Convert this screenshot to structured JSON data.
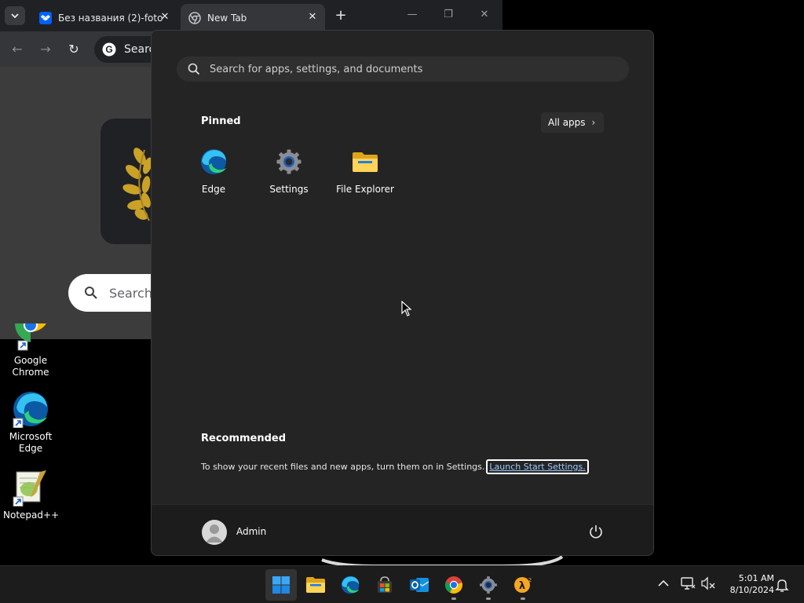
{
  "browser": {
    "tabs": [
      {
        "title": "Без названия (2)-foto"
      },
      {
        "title": "New Tab"
      }
    ],
    "toolbar": {
      "omnibox_text": "Search"
    },
    "ntp": {
      "search_text": "Search"
    }
  },
  "desktop": {
    "icons": [
      {
        "label": "Google\nChrome"
      },
      {
        "label": "Microsoft\nEdge"
      },
      {
        "label": "Notepad++"
      }
    ]
  },
  "start_menu": {
    "search_placeholder": "Search for apps, settings, and documents",
    "pinned_title": "Pinned",
    "all_apps_label": "All apps",
    "pinned_apps": [
      {
        "label": "Edge",
        "icon": "edge-icon"
      },
      {
        "label": "Settings",
        "icon": "settings-gear-icon"
      },
      {
        "label": "File Explorer",
        "icon": "folder-icon"
      }
    ],
    "recommended_title": "Recommended",
    "recommended_text": "To show your recent files and new apps, turn them on in Settings.",
    "recommended_link": "Launch Start Settings.",
    "user_name": "Admin"
  },
  "taskbar": {
    "apps": [
      "windows-start-icon",
      "file-explorer-icon",
      "edge-icon",
      "store-icon",
      "outlook-icon",
      "chrome-icon",
      "settings-icon",
      "half-life-icon"
    ],
    "time": "5:01 AM",
    "date": "8/10/2024"
  },
  "colors": {
    "start_bg": "#242424",
    "taskbar_bg": "#1c1c1c",
    "link": "#9ecbff",
    "accent_blue": "#0078d4"
  }
}
